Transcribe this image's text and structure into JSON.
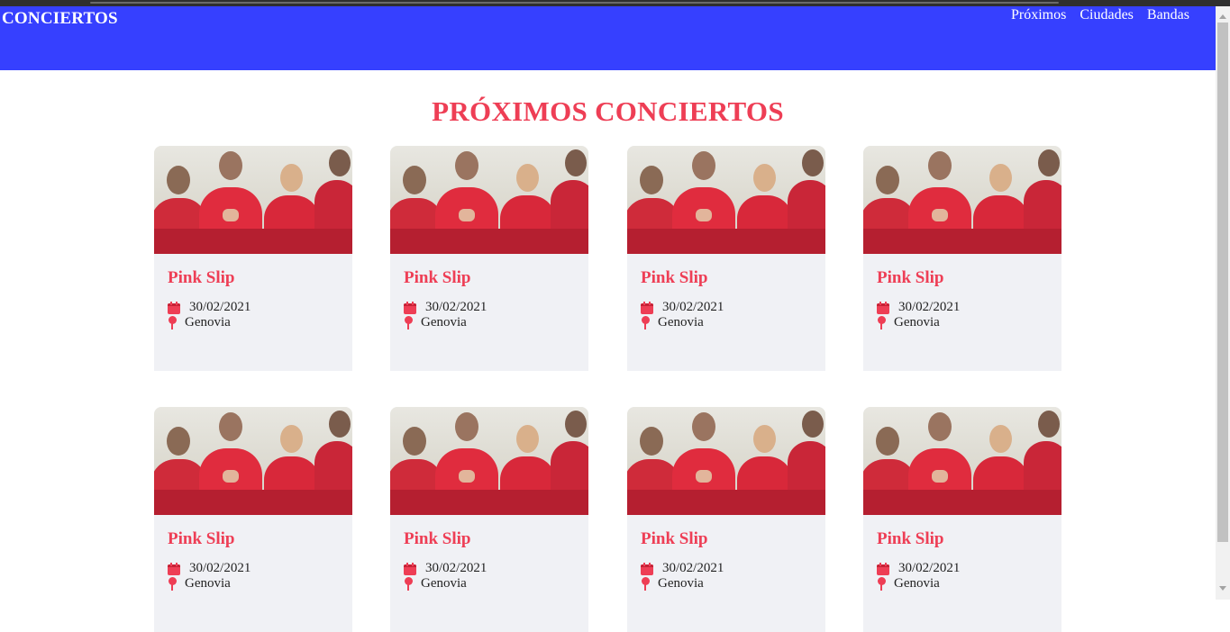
{
  "navbar": {
    "brand": "CONCIERTOS",
    "links": [
      {
        "label": "Próximos"
      },
      {
        "label": "Ciudades"
      },
      {
        "label": "Bandas"
      }
    ]
  },
  "main": {
    "title": "PRÓXIMOS CONCIERTOS"
  },
  "concerts": [
    {
      "title": "Pink Slip",
      "date": "30/02/2021",
      "location": "Genovia"
    },
    {
      "title": "Pink Slip",
      "date": "30/02/2021",
      "location": "Genovia"
    },
    {
      "title": "Pink Slip",
      "date": "30/02/2021",
      "location": "Genovia"
    },
    {
      "title": "Pink Slip",
      "date": "30/02/2021",
      "location": "Genovia"
    },
    {
      "title": "Pink Slip",
      "date": "30/02/2021",
      "location": "Genovia"
    },
    {
      "title": "Pink Slip",
      "date": "30/02/2021",
      "location": "Genovia"
    },
    {
      "title": "Pink Slip",
      "date": "30/02/2021",
      "location": "Genovia"
    },
    {
      "title": "Pink Slip",
      "date": "30/02/2021",
      "location": "Genovia"
    }
  ],
  "icons": {
    "date": "calendar-icon",
    "location": "map-pin-icon"
  },
  "colors": {
    "navbar": "#3640ff",
    "accent": "#ee3e55",
    "card_bg": "#f0f1f5"
  }
}
